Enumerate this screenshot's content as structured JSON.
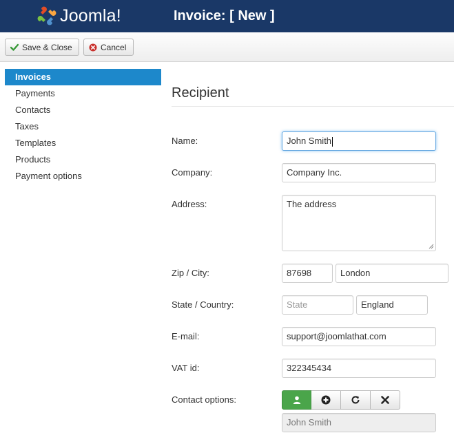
{
  "header": {
    "logo_text": "Joomla!",
    "page_title": "Invoice: [ New ]"
  },
  "toolbar": {
    "save_label": "Save & Close",
    "cancel_label": "Cancel"
  },
  "sidebar": {
    "items": [
      {
        "label": "Invoices",
        "active": true
      },
      {
        "label": "Payments"
      },
      {
        "label": "Contacts"
      },
      {
        "label": "Taxes"
      },
      {
        "label": "Templates"
      },
      {
        "label": "Products"
      },
      {
        "label": "Payment options"
      }
    ]
  },
  "form": {
    "section_title": "Recipient",
    "name": {
      "label": "Name:",
      "value": "John Smith"
    },
    "company": {
      "label": "Company:",
      "value": "Company Inc."
    },
    "address": {
      "label": "Address:",
      "value": "The address"
    },
    "zip_city": {
      "label": "Zip / City:",
      "zip": "87698",
      "city": "London"
    },
    "state_country": {
      "label": "State / Country:",
      "state_placeholder": "State",
      "country": "England"
    },
    "email": {
      "label": "E-mail:",
      "value": "support@joomlathat.com"
    },
    "vat": {
      "label": "VAT id:",
      "value": "322345434"
    },
    "contact_options": {
      "label": "Contact options:",
      "selected_contact": "John Smith"
    }
  },
  "colors": {
    "header_bg": "#1a3867",
    "active_nav": "#1d88cb",
    "contact_button": "#4aa54a"
  },
  "icons": {
    "save": "check-icon",
    "cancel": "cancel-circle-icon",
    "contact_options": [
      "user-icon",
      "plus-circle-icon",
      "refresh-icon",
      "remove-icon"
    ]
  }
}
